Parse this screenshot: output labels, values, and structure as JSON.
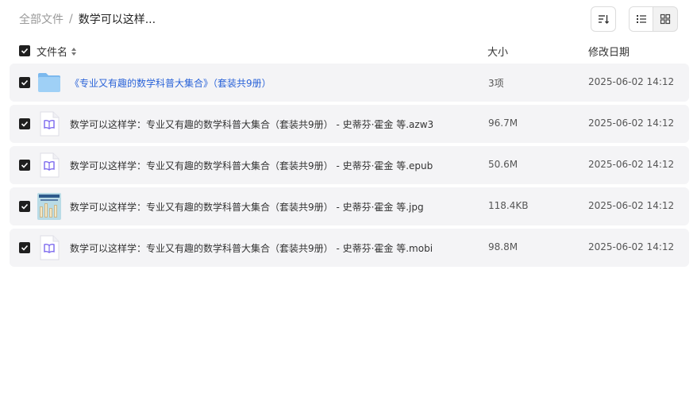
{
  "breadcrumb": {
    "root": "全部文件",
    "separator": "/",
    "current": "数学可以这样..."
  },
  "toolbar": {
    "sort_icon": "sort-icon",
    "list_view_icon": "list-view-icon",
    "grid_view_icon": "grid-view-icon"
  },
  "columns": {
    "name": "文件名",
    "size": "大小",
    "date": "修改日期"
  },
  "colors": {
    "folder_link": "#2a63d8",
    "row_bg": "#f4f4f6",
    "ebook_icon": "#7b68ee"
  },
  "files": [
    {
      "type": "folder",
      "icon": "folder-icon",
      "name": "《专业又有趣的数学科普大集合》（套装共9册）",
      "size": "3项",
      "date": "2025-06-02 14:12",
      "checked": true
    },
    {
      "type": "ebook",
      "icon": "ebook-icon",
      "name": "数学可以这样学：专业又有趣的数学科普大集合（套装共9册） - 史蒂芬·霍金 等.azw3",
      "size": "96.7M",
      "date": "2025-06-02 14:12",
      "checked": true
    },
    {
      "type": "ebook",
      "icon": "ebook-icon",
      "name": "数学可以这样学：专业又有趣的数学科普大集合（套装共9册） - 史蒂芬·霍金 等.epub",
      "size": "50.6M",
      "date": "2025-06-02 14:12",
      "checked": true
    },
    {
      "type": "image",
      "icon": "image-thumbnail",
      "name": "数学可以这样学：专业又有趣的数学科普大集合（套装共9册） - 史蒂芬·霍金 等.jpg",
      "size": "118.4KB",
      "date": "2025-06-02 14:12",
      "checked": true
    },
    {
      "type": "ebook",
      "icon": "ebook-icon",
      "name": "数学可以这样学：专业又有趣的数学科普大集合（套装共9册） - 史蒂芬·霍金 等.mobi",
      "size": "98.8M",
      "date": "2025-06-02 14:12",
      "checked": true
    }
  ]
}
